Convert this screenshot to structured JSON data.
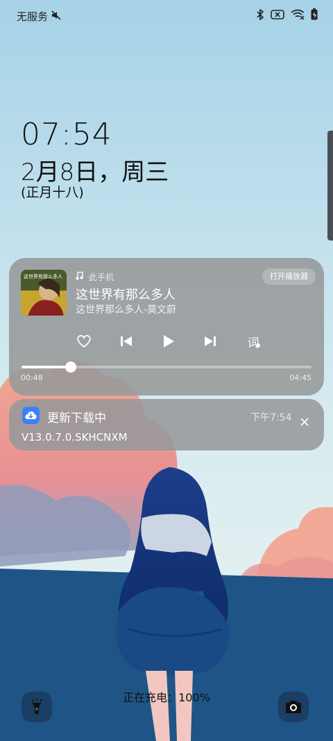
{
  "status_bar": {
    "carrier": "无服务",
    "icons": [
      "mute-icon",
      "bluetooth-icon",
      "sim-off-icon",
      "wifi-off-icon",
      "battery-charging-icon"
    ]
  },
  "clock": {
    "time": "07:54",
    "date": "2月8日，周三",
    "lunar": "(正月十八)"
  },
  "media": {
    "source": "此手机",
    "song": "这世界有那么多人",
    "artist_line": "这世界那么多人-莫文蔚",
    "open_player": "打开播放器",
    "elapsed": "00:48",
    "duration": "04:45",
    "progress_fraction": 0.17,
    "lyrics_label": "词",
    "album_cover_text": "这世界有那么多人"
  },
  "notification": {
    "title": "更新下载中",
    "time": "下午7:54",
    "body": "V13.0.7.0.SKHCNXM"
  },
  "bottom": {
    "charging": "正在充电：100%",
    "left_button": "flashlight-icon",
    "right_button": "camera-icon"
  },
  "colors": {
    "card_bg": "#96989a",
    "accent_blue": "#3b82f6",
    "sky_top": "#a6d2e8",
    "sea": "#1e5586"
  }
}
